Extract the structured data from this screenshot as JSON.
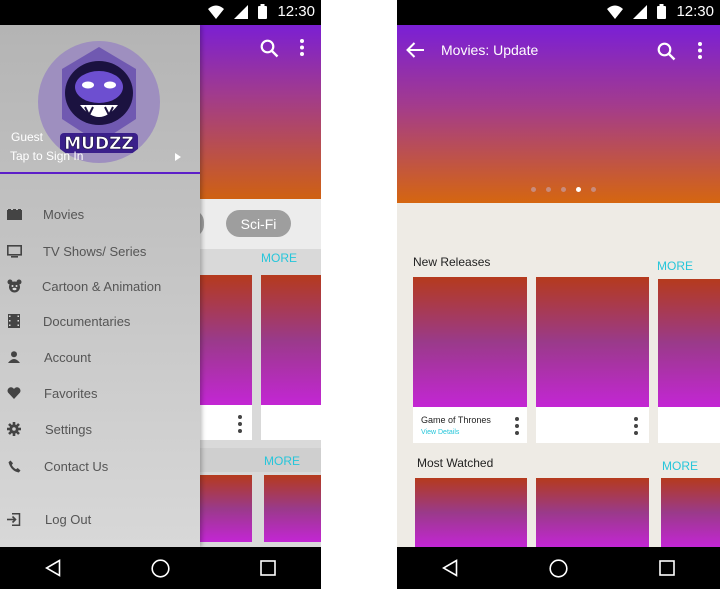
{
  "status": {
    "time": "12:30"
  },
  "left": {
    "drawer": {
      "logo_text": "MUDZZ",
      "user": "Guest",
      "signin": "Tap to Sign In",
      "items": [
        {
          "label": "Movies",
          "icon": "film-icon"
        },
        {
          "label": "TV Shows/ Series",
          "icon": "tv-icon"
        },
        {
          "label": "Cartoon & Animation",
          "icon": "bear-icon"
        },
        {
          "label": "Documentaries",
          "icon": "filmstrip-icon"
        },
        {
          "label": "Account",
          "icon": "person-icon"
        },
        {
          "label": "Favorites",
          "icon": "heart-icon"
        },
        {
          "label": "Settings",
          "icon": "gear-icon"
        },
        {
          "label": "Contact Us",
          "icon": "phone-icon"
        },
        {
          "label": "Log Out",
          "icon": "logout-icon"
        }
      ]
    },
    "chip": "Sci-Fi",
    "more1": "MORE",
    "more2": "MORE"
  },
  "right": {
    "title": "Movies: Update",
    "carousel": {
      "count": 5,
      "active_index": 3
    },
    "new_releases": {
      "title": "New Releases",
      "more": "MORE",
      "card1_title": "Game of Thrones",
      "card1_sub": "View Details"
    },
    "most_watched": {
      "title": "Most Watched",
      "more": "MORE"
    }
  },
  "colors": {
    "accent": "#26c6da",
    "gradient_top": "#7b1fd3",
    "gradient_bottom": "#cf6112",
    "drawer_divider": "#5c1ec8"
  }
}
